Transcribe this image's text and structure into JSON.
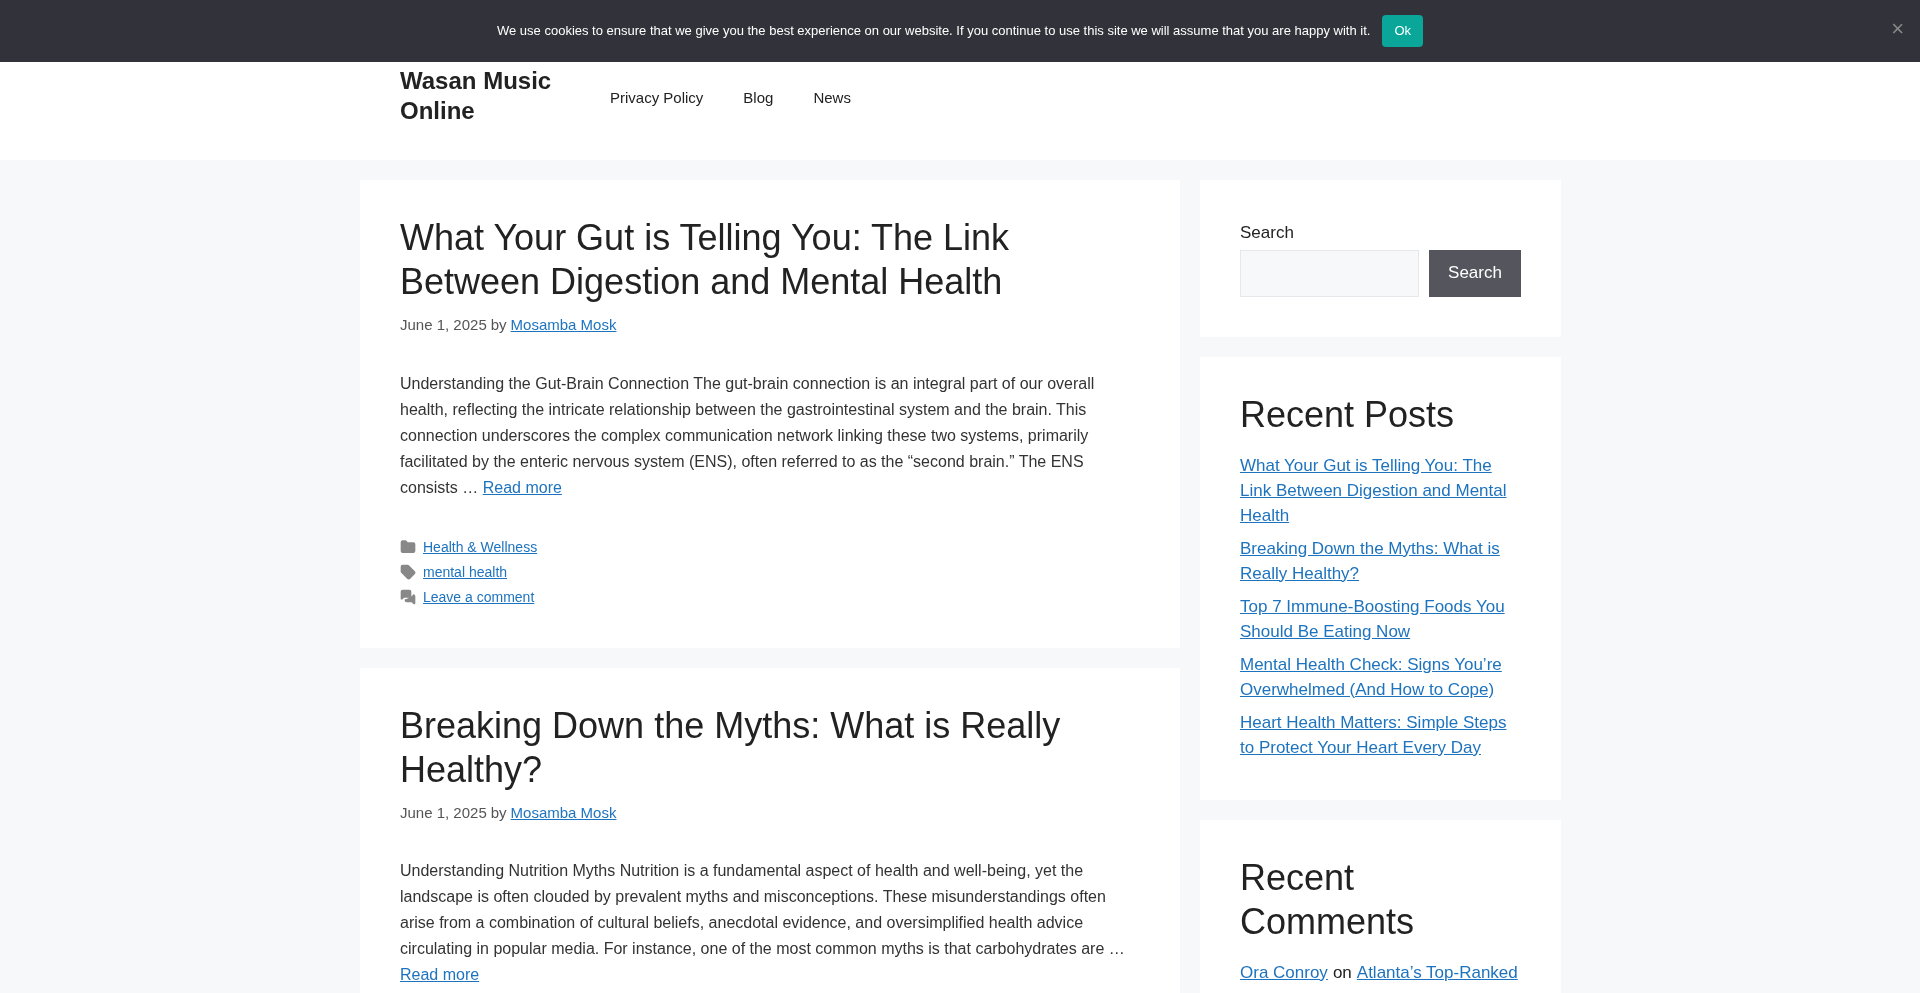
{
  "cookie_bar": {
    "message": "We use cookies to ensure that we give you the best experience on our website. If you continue to use this site we will assume that you are happy with it.",
    "ok_button": "Ok",
    "close": "×"
  },
  "header": {
    "site_title": "Wasan Music Online",
    "nav": [
      "Privacy Policy",
      "Blog",
      "News"
    ]
  },
  "posts": [
    {
      "title": "What Your Gut is Telling You: The Link Between Digestion and Mental Health",
      "date": "June 1, 2025",
      "by": "by",
      "author": "Mosamba Mosk",
      "excerpt": "Understanding the Gut-Brain Connection The gut-brain connection is an integral part of our overall health, reflecting the intricate relationship between the gastrointestinal system and the brain. This connection underscores the complex communication network linking these two systems, primarily facilitated by the enteric nervous system (ENS), often referred to as the “second brain.” The ENS consists …",
      "read_more": "Read more",
      "meta": [
        {
          "kind": "category",
          "text": "Health & Wellness"
        },
        {
          "kind": "tag",
          "text": "mental health"
        },
        {
          "kind": "comment",
          "text": "Leave a comment"
        }
      ]
    },
    {
      "title": "Breaking Down the Myths: What is Really Healthy?",
      "date": "June 1, 2025",
      "by": "by",
      "author": "Mosamba Mosk",
      "excerpt": "Understanding Nutrition Myths Nutrition is a fundamental aspect of health and well-being, yet the landscape is often clouded by prevalent myths and misconceptions. These misunderstandings often arise from a combination of cultural beliefs, anecdotal evidence, and oversimplified health advice circulating in popular media. For instance, one of the most common myths is that carbohydrates are …",
      "read_more": "Read more"
    }
  ],
  "sidebar": {
    "search": {
      "label": "Search",
      "button": "Search"
    },
    "recent_posts": {
      "heading": "Recent Posts",
      "items": [
        "What Your Gut is Telling You: The Link Between Digestion and Mental Health",
        "Breaking Down the Myths: What is Really Healthy?",
        "Top 7 Immune-Boosting Foods You Should Be Eating Now",
        "Mental Health Check: Signs You’re Overwhelmed (And How to Cope)",
        "Heart Health Matters: Simple Steps to Protect Your Heart Every Day"
      ]
    },
    "recent_comments": {
      "heading": "Recent Comments",
      "items": [
        {
          "author": "Ora Conroy",
          "on": "on",
          "post": "Atlanta’s Top-Ranked"
        }
      ]
    }
  }
}
